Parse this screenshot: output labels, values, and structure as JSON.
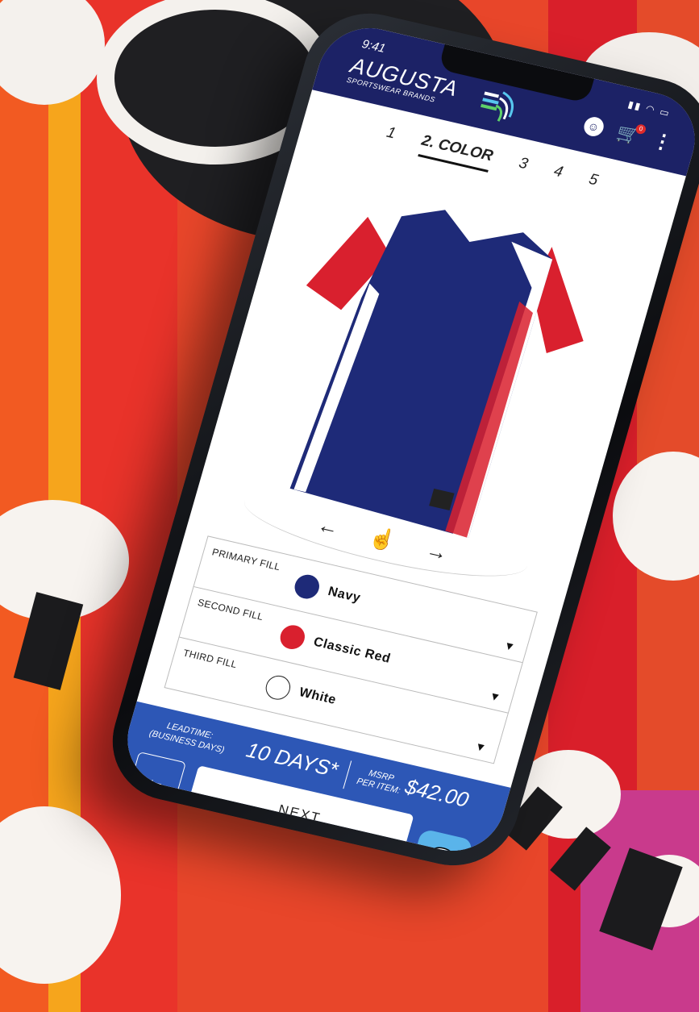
{
  "colors": {
    "header_bg": "#1c2266",
    "footer_bg": "#2d57b6",
    "chat_bg": "#5ab4ea",
    "navy": "#1e2a78",
    "classic_red": "#d9202e",
    "white": "#ffffff",
    "cart_badge": "#e02a2a"
  },
  "status_bar": {
    "time": "9:41"
  },
  "header": {
    "brand_name": "AUGUSTA",
    "brand_sub": "SPORTSWEAR BRANDS",
    "cart_count": "0"
  },
  "steps": [
    {
      "label": "1",
      "active": false
    },
    {
      "label": "2. COLOR",
      "active": true
    },
    {
      "label": "3",
      "active": false
    },
    {
      "label": "4",
      "active": false
    },
    {
      "label": "5",
      "active": false
    }
  ],
  "rotate": {
    "left": "←",
    "right": "→"
  },
  "fills": [
    {
      "label": "PRIMARY FILL",
      "value": "Navy",
      "swatch": "#1e2a78"
    },
    {
      "label": "SECOND FILL",
      "value": "Classic Red",
      "swatch": "#d9202e"
    },
    {
      "label": "THIRD FILL",
      "value": "White",
      "swatch": "#ffffff"
    }
  ],
  "footer": {
    "lead_label": "LEADTIME:\n(BUSINESS DAYS)",
    "lead_value": "10 DAYS*",
    "msrp_label": "MSRP\nPER ITEM:",
    "msrp_value": "$42.00",
    "back_label": "←",
    "next_label": "NEXT"
  }
}
